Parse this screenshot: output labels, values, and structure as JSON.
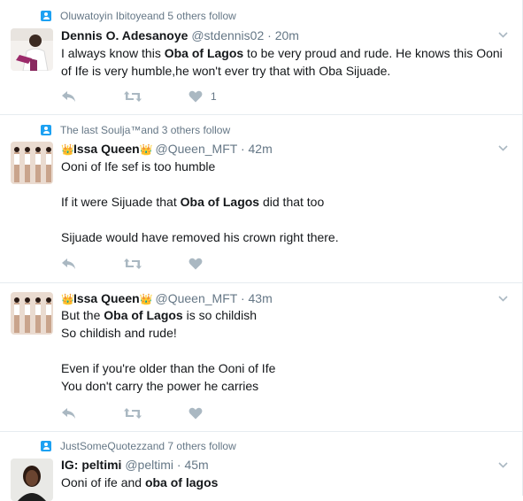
{
  "tweets": [
    {
      "context": {
        "link": "Oluwatoyin Ibitoye",
        "rest": " and 5 others follow"
      },
      "name": "Dennis O. Adesanoye",
      "handle": "@stdennis02",
      "sep": "·",
      "time": "20m",
      "lines": [
        [
          "I always know this ",
          "Oba of Lagos",
          " to be very proud and rude. He knows this Ooni"
        ],
        [
          "of Ife is very humble,he won't ever try that with Oba Sijuade."
        ]
      ],
      "like_count": "1"
    },
    {
      "context": {
        "link": "The last Soulja™",
        "rest": " and 3 others follow"
      },
      "crown": "👑",
      "name": "Issa Queen",
      "handle": "@Queen_MFT",
      "sep": "·",
      "time": "42m",
      "lines": [
        [
          "Ooni of Ife sef is too humble"
        ],
        [
          "If it were Sijuade that ",
          "Oba of Lagos",
          " did that too"
        ],
        [
          "Sijuade would have removed his crown right there."
        ]
      ]
    },
    {
      "crown": "👑",
      "name": "Issa Queen",
      "handle": "@Queen_MFT",
      "sep": "·",
      "time": "43m",
      "lines": [
        [
          "But the ",
          "Oba of Lagos",
          " is so childish"
        ],
        [
          "So childish and rude!"
        ],
        [
          "Even if you're older than the Ooni of Ife"
        ],
        [
          "You don't carry the power he carries"
        ]
      ]
    },
    {
      "context": {
        "link": "JustSomeQuotezz",
        "rest": " and 7 others follow"
      },
      "name": "IG: peltimi",
      "handle": "@peltimi",
      "sep": "·",
      "time": "45m",
      "lines": [
        [
          "Ooni of ife and ",
          "oba of lagos"
        ]
      ]
    }
  ],
  "icons": {
    "context": "person-icon",
    "reply": "reply-icon",
    "retweet": "retweet-icon",
    "like": "heart-icon",
    "caret": "chevron-down-icon"
  },
  "colors": {
    "accent": "#1da1f2",
    "muted": "#657786",
    "icon": "#aab8c2",
    "divider": "#e6ecf0"
  }
}
